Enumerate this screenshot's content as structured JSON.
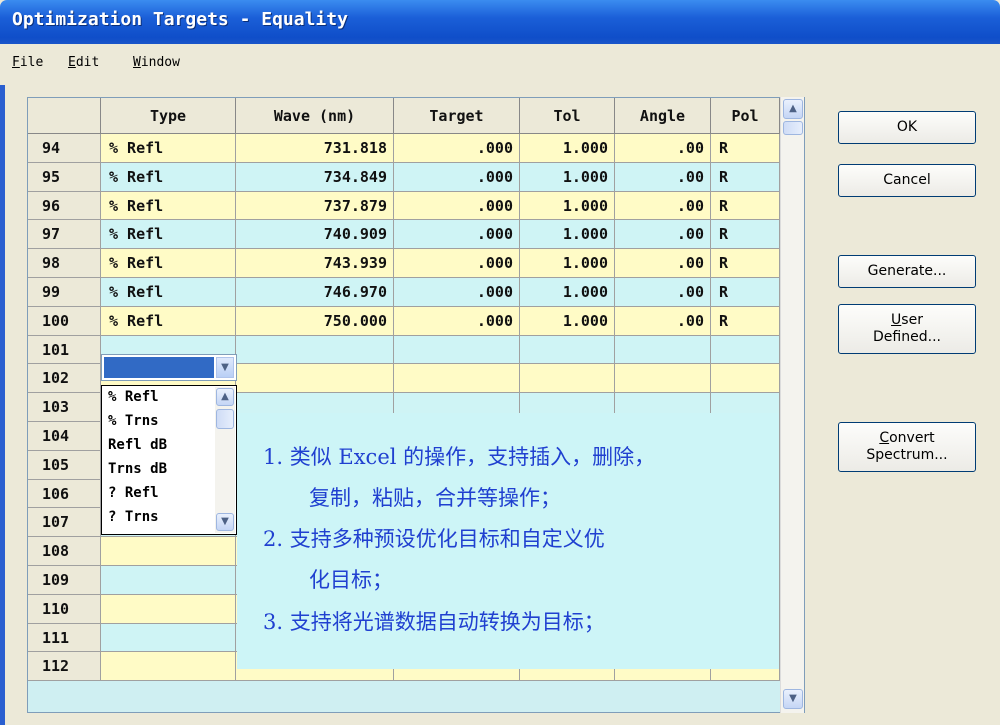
{
  "window": {
    "title": "Optimization Targets - Equality"
  },
  "menu": [
    "File",
    "Edit",
    "Window"
  ],
  "table": {
    "columns": [
      "",
      "Type",
      "Wave (nm)",
      "Target",
      "Tol",
      "Angle",
      "Pol"
    ],
    "rows": [
      {
        "n": "94",
        "type": "% Refl",
        "wave": "731.818",
        "target": ".000",
        "tol": "1.000",
        "angle": ".00",
        "pol": "R"
      },
      {
        "n": "95",
        "type": "% Refl",
        "wave": "734.849",
        "target": ".000",
        "tol": "1.000",
        "angle": ".00",
        "pol": "R"
      },
      {
        "n": "96",
        "type": "% Refl",
        "wave": "737.879",
        "target": ".000",
        "tol": "1.000",
        "angle": ".00",
        "pol": "R"
      },
      {
        "n": "97",
        "type": "% Refl",
        "wave": "740.909",
        "target": ".000",
        "tol": "1.000",
        "angle": ".00",
        "pol": "R"
      },
      {
        "n": "98",
        "type": "% Refl",
        "wave": "743.939",
        "target": ".000",
        "tol": "1.000",
        "angle": ".00",
        "pol": "R"
      },
      {
        "n": "99",
        "type": "% Refl",
        "wave": "746.970",
        "target": ".000",
        "tol": "1.000",
        "angle": ".00",
        "pol": "R"
      },
      {
        "n": "100",
        "type": "% Refl",
        "wave": "750.000",
        "target": ".000",
        "tol": "1.000",
        "angle": ".00",
        "pol": "R"
      }
    ],
    "empty_rows": [
      "101",
      "102",
      "103",
      "104",
      "105",
      "106",
      "107",
      "108",
      "109",
      "110",
      "111",
      "112"
    ]
  },
  "type_dropdown": {
    "options": [
      "% Refl",
      "% Trns",
      "Refl dB",
      "Trns dB",
      "? Refl",
      "? Trns"
    ]
  },
  "buttons": {
    "ok": "OK",
    "cancel": "Cancel",
    "generate": "Generate...",
    "user_defined": [
      "User",
      "Defined..."
    ],
    "convert": [
      "Convert",
      "Spectrum..."
    ]
  },
  "annotation": {
    "lines": [
      "1.   类似 Excel 的操作，支持插入，删除，",
      "复制，粘贴，合并等操作；",
      "2.   支持多种预设优化目标和自定义优",
      "化目标；",
      "3.   支持将光谱数据自动转换为目标；"
    ]
  },
  "colors": {
    "row_yellow": "#fffbc6",
    "row_cyan": "#cff4f5",
    "annotation_text": "#2040d0",
    "selection": "#316ac5"
  }
}
